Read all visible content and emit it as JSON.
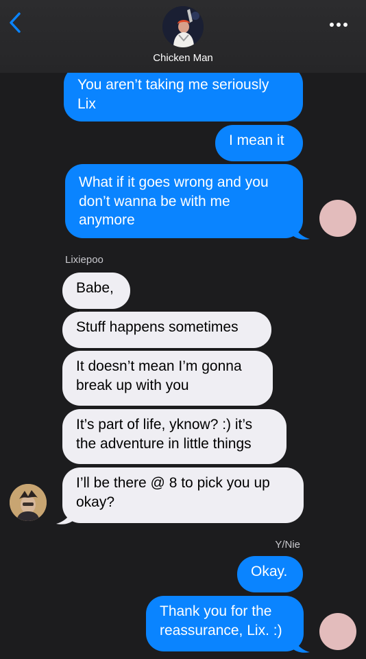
{
  "header": {
    "contact_name": "Chicken Man",
    "back_icon": "chevron-left-icon",
    "more_icon": "ellipsis-icon"
  },
  "colors": {
    "outgoing_bubble": "#0a84ff",
    "incoming_bubble": "#efeef3",
    "background": "#1c1c1e",
    "accent": "#0a84ff",
    "blush_avatar": "#e3bcbc"
  },
  "messages": [
    {
      "direction": "outgoing",
      "text": "You aren’t taking me seriously Lix"
    },
    {
      "direction": "outgoing",
      "text": "I mean it"
    },
    {
      "direction": "outgoing",
      "text": "What if it goes wrong and you don’t wanna be with me anymore"
    },
    {
      "direction": "incoming",
      "text": "Babe,,"
    },
    {
      "direction": "incoming",
      "text": "Stuff happens sometimes"
    },
    {
      "direction": "incoming",
      "text": "It doesn’t mean I’m gonna break up with you"
    },
    {
      "direction": "incoming",
      "text": "It’s part of life, yknow? :) it’s the adventure in little things"
    },
    {
      "direction": "incoming",
      "text": "I’ll be there @ 8 to pick you up okay?"
    },
    {
      "direction": "outgoing",
      "text": "Okay."
    },
    {
      "direction": "outgoing",
      "text": "Thank you for the reassurance, Lix. :)"
    }
  ],
  "senders": {
    "incoming_name": "Lixiepoo",
    "outgoing_name": "Y/Nie"
  }
}
